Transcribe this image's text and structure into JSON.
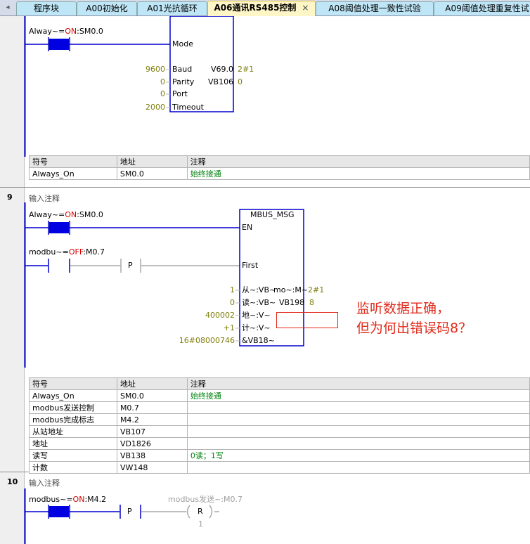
{
  "tabs": {
    "scroll_left": "◂",
    "items": [
      "程序块",
      "A00初始化",
      "A01光抗循环",
      "A06通讯RS485控制",
      "A08阈值处理一致性试验",
      "A09阈值处理重复性试"
    ],
    "active_close": "×"
  },
  "net_top": {
    "contact_label": "Alway~=",
    "contact_state": "ON",
    "contact_addr": ":SM0.0",
    "box_pins": [
      "Mode",
      "Baud",
      "Parity",
      "Port",
      "Timeout"
    ],
    "inputs": [
      "9600",
      "0",
      "0",
      "2000"
    ],
    "outputs": [
      "V69.0",
      "VB106"
    ],
    "out_vals": [
      "2#1",
      "0"
    ],
    "symbols": {
      "headers": [
        "符号",
        "地址",
        "注释"
      ],
      "rows": [
        [
          "Always_On",
          "SM0.0",
          "始终接通"
        ]
      ]
    }
  },
  "net9": {
    "number": "9",
    "comment": "输入注释",
    "contact1_label": "Alway~=",
    "contact1_state": "ON",
    "contact1_addr": ":SM0.0",
    "contact2_label": "modbu~=",
    "contact2_state": "OFF",
    "contact2_addr": ":M0.7",
    "p_label": "P",
    "box_title": "MBUS_MSG",
    "pins": [
      "EN",
      "First"
    ],
    "params": [
      {
        "value": "1",
        "pin": "从~:VB~",
        "pin2": "mo~:M~",
        "out": "2#1"
      },
      {
        "value": "0",
        "pin": "读~:VB~",
        "pin2": "VB198",
        "out": "8"
      },
      {
        "value": "400002",
        "pin": "地~:V~"
      },
      {
        "value": "+1",
        "pin": "计~:V~"
      },
      {
        "value": "16#08000746",
        "pin": "&VB18~"
      }
    ],
    "symbols": {
      "headers": [
        "符号",
        "地址",
        "注释"
      ],
      "rows": [
        [
          "Always_On",
          "SM0.0",
          "始终接通"
        ],
        [
          "modbus发送控制",
          "M0.7",
          ""
        ],
        [
          "modbus完成标志",
          "M4.2",
          ""
        ],
        [
          "从站地址",
          "VB107",
          ""
        ],
        [
          "地址",
          "VD1826",
          ""
        ],
        [
          "读写",
          "VB138",
          "0读；1写"
        ],
        [
          "计数",
          "VW148",
          ""
        ]
      ]
    }
  },
  "net10": {
    "number": "10",
    "comment": "输入注释",
    "contact_label": "modbus~=",
    "contact_state": "ON",
    "contact_addr": ":M4.2",
    "p_label": "P",
    "coil_label": "modbus发送~:M0.7",
    "coil_type": "R",
    "coil_n": "1"
  },
  "annotation": {
    "line1": "监听数据正确，",
    "line2": "但为何出错误码8？"
  },
  "colors": {
    "wire": "#0000cc",
    "contact_fill": "#0000e0",
    "inactive_wire": "#a8a8a8",
    "annotation": "#e02a1b"
  }
}
